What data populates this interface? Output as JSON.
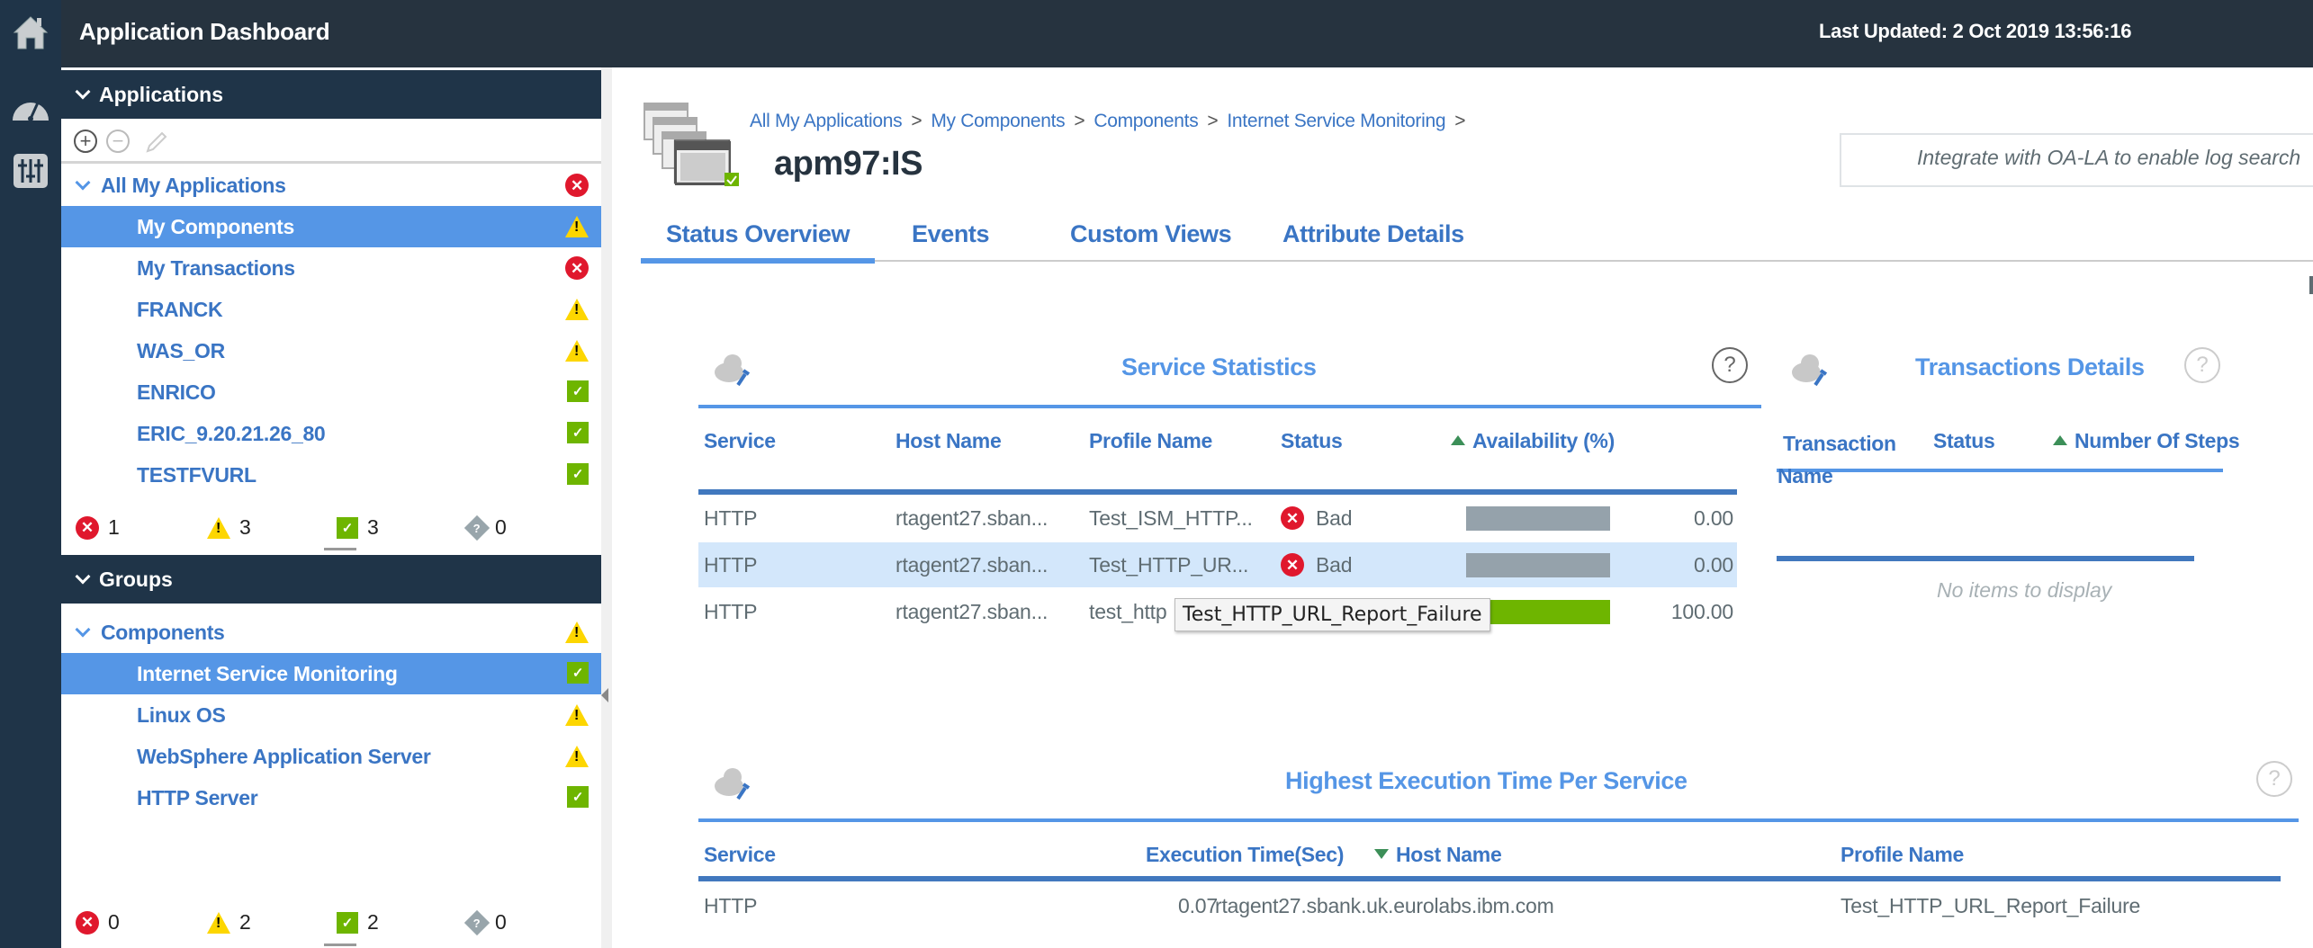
{
  "header": {
    "title": "Application Dashboard",
    "last_updated": "Last Updated: 2 Oct 2019 13:56:16"
  },
  "rail": {
    "icons": [
      "home-icon",
      "dashboard-gauge-icon",
      "settings-sliders-icon"
    ]
  },
  "applications": {
    "heading": "Applications",
    "toolbar": {
      "add": "+",
      "remove": "−",
      "edit": "edit"
    },
    "root": {
      "label": "All My Applications",
      "status": "critical"
    },
    "items": [
      {
        "label": "My Components",
        "status": "warning",
        "selected": true
      },
      {
        "label": "My Transactions",
        "status": "critical"
      },
      {
        "label": "FRANCK",
        "status": "warning"
      },
      {
        "label": "WAS_OR",
        "status": "warning"
      },
      {
        "label": "ENRICO",
        "status": "normal"
      },
      {
        "label": "ERIC_9.20.21.26_80",
        "status": "normal"
      },
      {
        "label": "TESTFVURL",
        "status": "normal"
      }
    ],
    "counts": {
      "critical": "1",
      "warning": "3",
      "normal": "3",
      "unknown": "0"
    }
  },
  "groups": {
    "heading": "Groups",
    "root": {
      "label": "Components",
      "status": "warning"
    },
    "items": [
      {
        "label": "Internet Service Monitoring",
        "status": "normal",
        "selected": true
      },
      {
        "label": "Linux OS",
        "status": "warning"
      },
      {
        "label": "WebSphere Application Server",
        "status": "warning"
      },
      {
        "label": "HTTP Server",
        "status": "normal"
      }
    ],
    "counts": {
      "critical": "0",
      "warning": "2",
      "normal": "2",
      "unknown": "0"
    }
  },
  "main": {
    "breadcrumb": [
      "All My Applications",
      "My Components",
      "Components",
      "Internet Service Monitoring"
    ],
    "breadcrumb_sep": ">",
    "title": "apm97:IS",
    "oala_text": "Integrate with OA-LA to enable log search",
    "tabs": [
      {
        "label": "Status Overview",
        "active": true
      },
      {
        "label": "Events"
      },
      {
        "label": "Custom Views"
      },
      {
        "label": "Attribute Details"
      }
    ]
  },
  "service_statistics": {
    "title": "Service Statistics",
    "help": "?",
    "columns": [
      "Service",
      "Host Name",
      "Profile Name",
      "Status",
      "Availability (%)"
    ],
    "sorted_column": "Availability (%)",
    "sort_direction": "ascending",
    "rows": [
      {
        "service": "HTTP",
        "host": "rtagent27.sban...",
        "profile": "Test_ISM_HTTP...",
        "status": "Bad",
        "status_level": "critical",
        "availability": 0.0,
        "availability_text": "0.00"
      },
      {
        "service": "HTTP",
        "host": "rtagent27.sban...",
        "profile": "Test_HTTP_UR...",
        "status": "Bad",
        "status_level": "critical",
        "availability": 0.0,
        "availability_text": "0.00",
        "highlighted": true
      },
      {
        "service": "HTTP",
        "host": "rtagent27.sban...",
        "profile": "test_http",
        "status": "",
        "status_level": "normal",
        "availability": 100.0,
        "availability_text": "100.00"
      }
    ],
    "tooltip": "Test_HTTP_URL_Report_Failure"
  },
  "transactions_details": {
    "title": "Transactions Details",
    "help": "?",
    "columns": [
      "Transaction Name",
      "Status",
      "Number Of Steps"
    ],
    "column_transaction_line1": "Transaction",
    "column_transaction_line2": "Name",
    "sorted_column": "Number Of Steps",
    "empty_message": "No items to display"
  },
  "highest_execution": {
    "title": "Highest Execution Time Per Service",
    "help": "?",
    "columns": [
      "Service",
      "Execution Time(Sec)",
      "Host Name",
      "Profile Name"
    ],
    "sorted_column": "Host Name",
    "sort_direction": "descending",
    "rows": [
      {
        "service": "HTTP",
        "execution_time": "0.07",
        "host": "rtagent27.sbank.uk.eurolabs.ibm.com",
        "profile": "Test_HTTP_URL_Report_Failure"
      }
    ]
  },
  "colors": {
    "critical": "#e0182d",
    "warning": "#fdd600",
    "normal": "#6eb500",
    "unknown": "#98a5ab",
    "accent": "#5596e6",
    "link": "#3a75c4",
    "header_bg": "#26333f",
    "rail_bg": "#1f3448",
    "bar_bad": "#95a2ab"
  }
}
